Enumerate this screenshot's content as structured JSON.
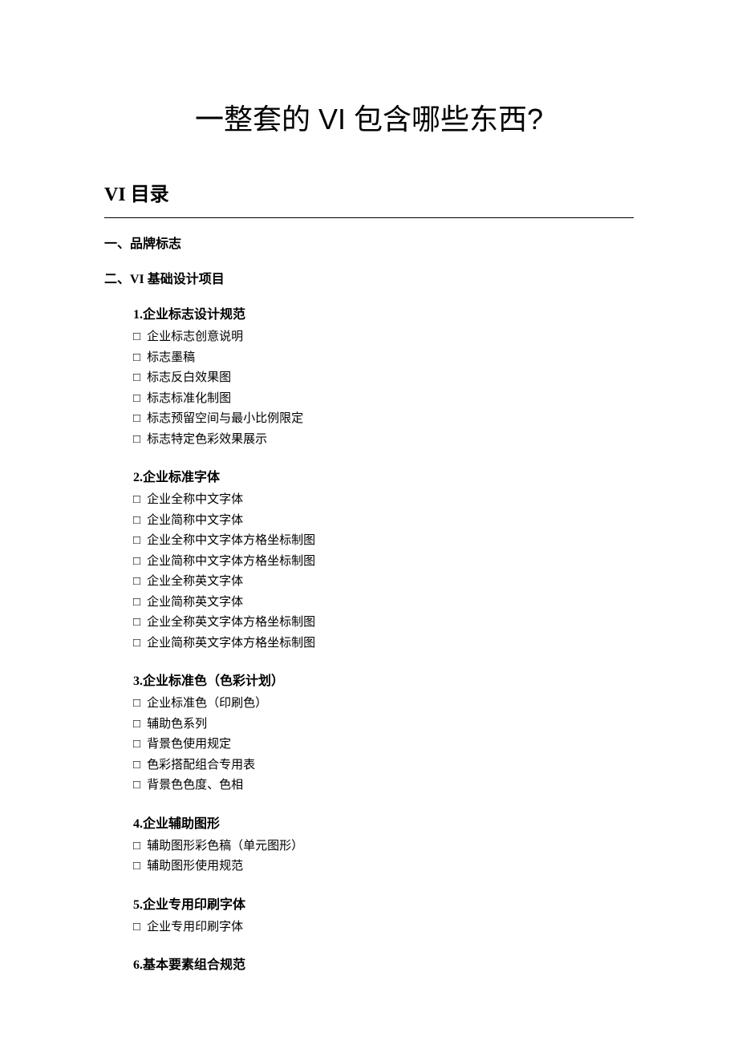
{
  "title": "一整套的 VI 包含哪些东西?",
  "subtitle": "VI 目录",
  "section1": {
    "heading": "一、品牌标志"
  },
  "section2": {
    "heading": "二、VI 基础设计项目",
    "subsections": [
      {
        "heading": "1.企业标志设计规范",
        "items": [
          "企业标志创意说明",
          "标志墨稿",
          "标志反白效果图",
          "标志标准化制图",
          "标志预留空间与最小比例限定",
          "标志特定色彩效果展示"
        ]
      },
      {
        "heading": "2.企业标准字体",
        "items": [
          "企业全称中文字体",
          "企业简称中文字体",
          "企业全称中文字体方格坐标制图",
          "企业简称中文字体方格坐标制图",
          "企业全称英文字体",
          "企业简称英文字体",
          "企业全称英文字体方格坐标制图",
          "企业简称英文字体方格坐标制图"
        ]
      },
      {
        "heading": "3.企业标准色（色彩计划）",
        "items": [
          "企业标准色（印刷色）",
          "辅助色系列",
          "背景色使用规定",
          "色彩搭配组合专用表",
          "背景色色度、色相"
        ]
      },
      {
        "heading": "4.企业辅助图形",
        "items": [
          "辅助图形彩色稿（单元图形）",
          "辅助图形使用规范"
        ]
      },
      {
        "heading": "5.企业专用印刷字体",
        "items": [
          "企业专用印刷字体"
        ]
      },
      {
        "heading": "6.基本要素组合规范",
        "items": []
      }
    ]
  },
  "checkbox_symbol": "□"
}
